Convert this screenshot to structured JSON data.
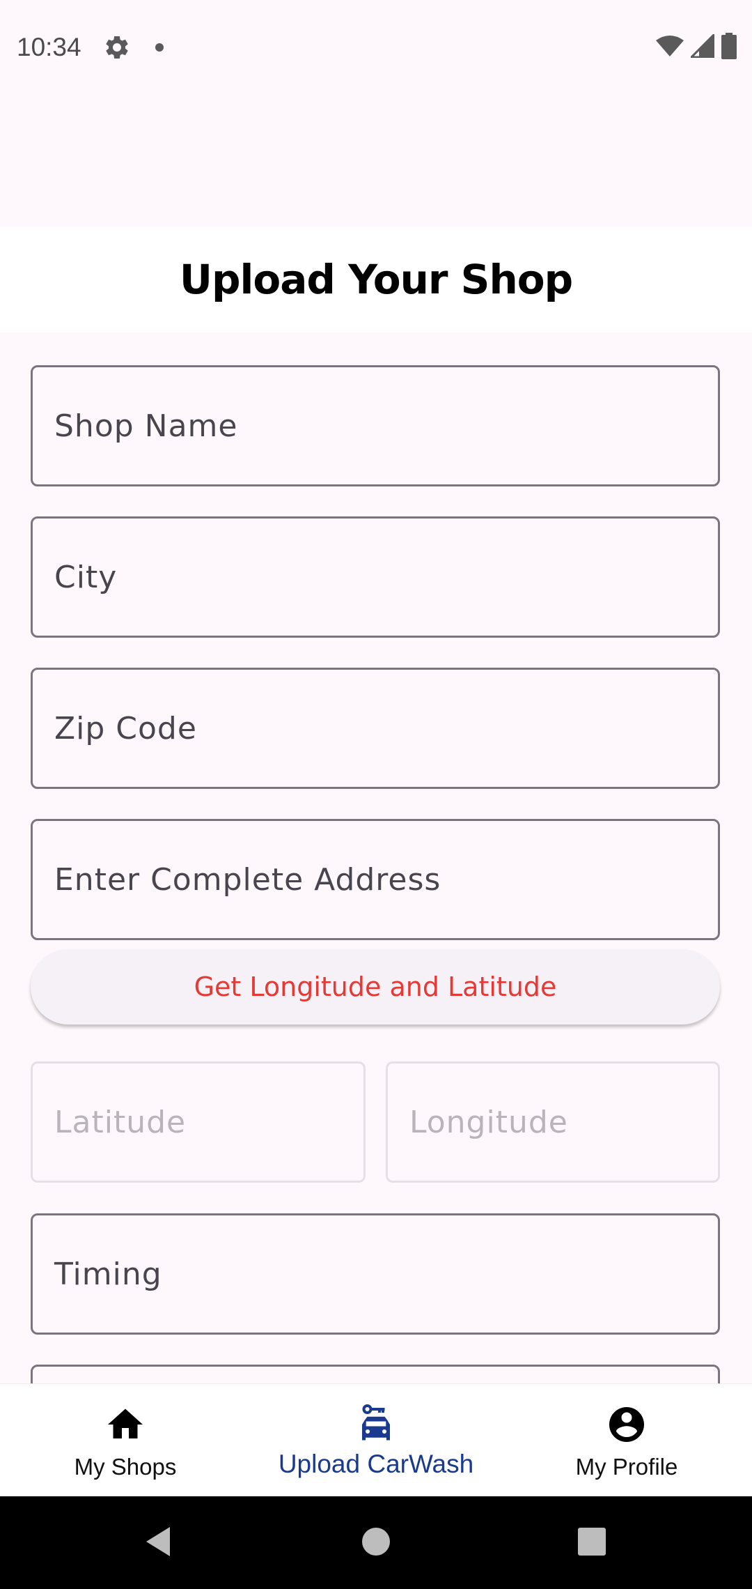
{
  "status_bar": {
    "time": "10:34"
  },
  "header": {
    "title": "Upload Your Shop"
  },
  "form": {
    "fields": [
      {
        "placeholder": "Shop Name"
      },
      {
        "placeholder": "City"
      },
      {
        "placeholder": "Zip Code"
      },
      {
        "placeholder": "Enter Complete Address"
      }
    ],
    "geo_button_label": "Get Longitude and Latitude",
    "latitude_placeholder": "Latitude",
    "longitude_placeholder": "Longitude",
    "timing_placeholder": "Timing"
  },
  "bottom_nav": {
    "items": [
      {
        "label": "My Shops",
        "icon": "home-icon"
      },
      {
        "label": "Upload CarWash",
        "icon": "car-wash-icon",
        "active": true
      },
      {
        "label": "My Profile",
        "icon": "account-circle-icon"
      }
    ]
  },
  "colors": {
    "accent": "#1A3A8F",
    "geo_button_text": "#E53935",
    "field_border": "#79747E",
    "background": "#FEF7FB"
  }
}
